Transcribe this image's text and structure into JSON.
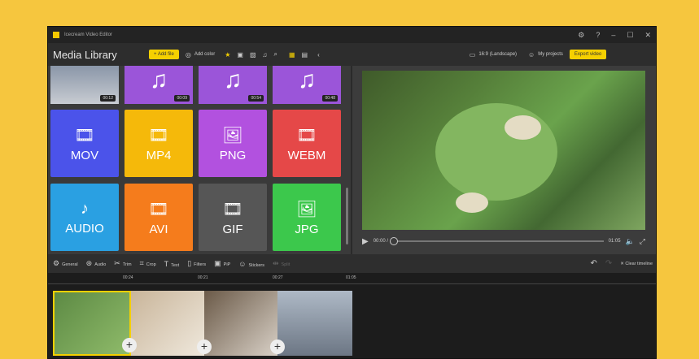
{
  "app": {
    "title": "Icecream Video Editor",
    "window_controls": [
      "⚙",
      "?",
      "–",
      "☐",
      "✕"
    ]
  },
  "toolbar": {
    "title": "Media Library",
    "add_file": "+ Add file",
    "add_color": "Add color",
    "aspect": "16:9 (Landscape)",
    "my_projects": "My projects",
    "export": "Export video"
  },
  "media": {
    "audio_durations": [
      "00:09",
      "00:54",
      "00:48"
    ],
    "video_duration": "00:12",
    "tiles": [
      {
        "label": "MOV",
        "color": "#4b53ea",
        "glyph": "🎞"
      },
      {
        "label": "MP4",
        "color": "#f5b90a",
        "glyph": "🎞"
      },
      {
        "label": "PNG",
        "color": "#b251df",
        "glyph": "🖼"
      },
      {
        "label": "WEBM",
        "color": "#e54848",
        "glyph": "🎞"
      },
      {
        "label": "AUDIO",
        "color": "#2aa0e2",
        "glyph": "♪"
      },
      {
        "label": "AVI",
        "color": "#f57c1c",
        "glyph": "🎞"
      },
      {
        "label": "GIF",
        "color": "#565656",
        "glyph": "🎞"
      },
      {
        "label": "JPG",
        "color": "#3cc84c",
        "glyph": "🖼"
      }
    ]
  },
  "player": {
    "current": "00:00 /",
    "total": "01:05",
    "progress": 0
  },
  "edit_tools": [
    "General",
    "Audio",
    "Trim",
    "Crop",
    "Text",
    "Filters",
    "PiP",
    "Stickers",
    "Split"
  ],
  "edit_right": {
    "clear": "Clear timeline"
  },
  "timeline": {
    "ticks": [
      "00:24",
      "00:21",
      "00:27",
      "01:05"
    ]
  }
}
